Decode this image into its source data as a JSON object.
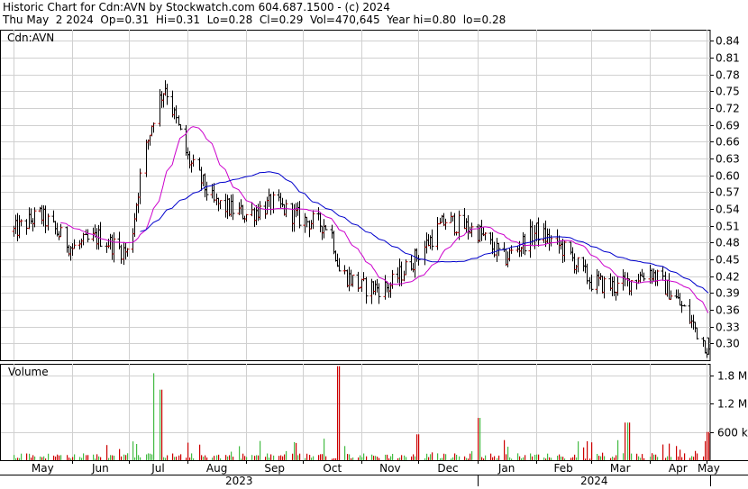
{
  "header": {
    "line1": "Historic Chart for Cdn:AVN by Stockwatch.com 604.687.1500 - (c) 2024",
    "line2": "Thu May  2 2024  Op=0.31  Hi=0.31  Lo=0.28  Cl=0.29  Vol=470,645  Year hi=0.80  lo=0.28"
  },
  "colors": {
    "up_bar": "#cc0000",
    "down_bar": "#000000",
    "ma_short": "#cc00cc",
    "ma_long": "#0000cc",
    "vol_up": "#44bb44",
    "vol_down": "#cc0000",
    "grid": "#d0d0d0"
  },
  "chart_data": [
    {
      "type": "ohlc",
      "title": "Cdn:AVN",
      "ylim": [
        0.27,
        0.86
      ],
      "y_ticks": [
        "0.84",
        "0.81",
        "0.78",
        "0.75",
        "0.72",
        "0.69",
        "0.66",
        "0.63",
        "0.60",
        "0.57",
        "0.54",
        "0.51",
        "0.48",
        "0.45",
        "0.42",
        "0.39",
        "0.36",
        "0.33",
        "0.30"
      ],
      "x_months": [
        "May",
        "Jun",
        "Jul",
        "Aug",
        "Sep",
        "Oct",
        "Nov",
        "Dec",
        "Jan",
        "Feb",
        "Mar",
        "Apr",
        "May"
      ],
      "x_years": [
        "2023",
        "2024"
      ],
      "close_approx": [
        [
          "2023-05",
          0.5
        ],
        [
          "2023-05-15",
          0.53
        ],
        [
          "2023-06-01",
          0.47
        ],
        [
          "2023-06-15",
          0.49
        ],
        [
          "2023-07-01",
          0.46
        ],
        [
          "2023-07-08",
          0.62
        ],
        [
          "2023-07-15",
          0.72
        ],
        [
          "2023-07-20",
          0.76
        ],
        [
          "2023-08-01",
          0.63
        ],
        [
          "2023-08-15",
          0.55
        ],
        [
          "2023-09-01",
          0.53
        ],
        [
          "2023-09-15",
          0.55
        ],
        [
          "2023-10-01",
          0.52
        ],
        [
          "2023-10-15",
          0.51
        ],
        [
          "2023-10-20",
          0.43
        ],
        [
          "2023-11-01",
          0.4
        ],
        [
          "2023-11-15",
          0.4
        ],
        [
          "2023-12-01",
          0.46
        ],
        [
          "2023-12-15",
          0.52
        ],
        [
          "2024-01-01",
          0.5
        ],
        [
          "2024-01-15",
          0.45
        ],
        [
          "2024-02-01",
          0.5
        ],
        [
          "2024-02-15",
          0.47
        ],
        [
          "2024-03-01",
          0.41
        ],
        [
          "2024-03-15",
          0.4
        ],
        [
          "2024-04-01",
          0.43
        ],
        [
          "2024-04-15",
          0.38
        ],
        [
          "2024-05-02",
          0.29
        ]
      ],
      "series": [
        {
          "name": "",
          "role": "moving-average-short"
        },
        {
          "name": "",
          "role": "moving-average-long"
        }
      ]
    },
    {
      "type": "bar",
      "title": "Volume",
      "y_ticks": [
        "1.8 M",
        "1.2 M",
        "600 k"
      ],
      "peaks_approx": [
        [
          "2023-07-15",
          1.85
        ],
        [
          "2023-07-17",
          1.5
        ],
        [
          "2023-10-20",
          2.0
        ],
        [
          "2023-12-01",
          0.55
        ],
        [
          "2024-01-01",
          0.9
        ],
        [
          "2024-03-20",
          0.8
        ],
        [
          "2024-05-02",
          0.6
        ]
      ]
    }
  ]
}
